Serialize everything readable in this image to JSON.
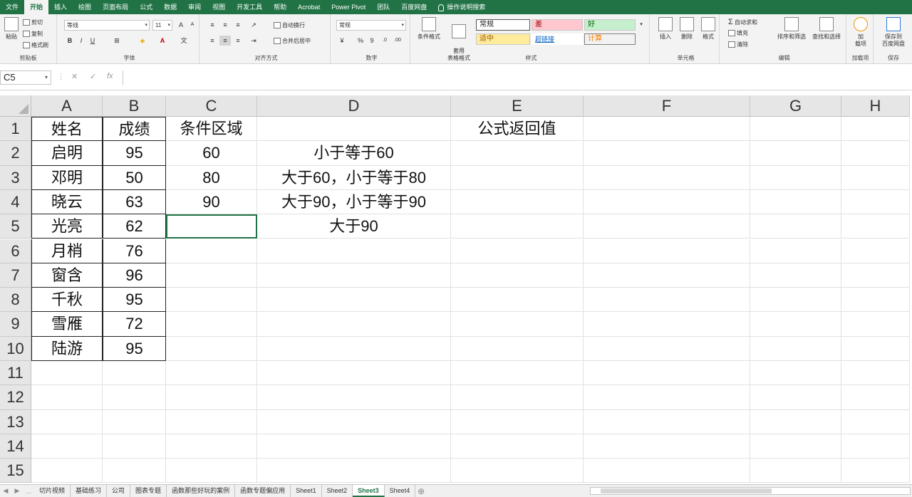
{
  "ribbon_tabs": [
    "文件",
    "开始",
    "插入",
    "绘图",
    "页面布局",
    "公式",
    "数据",
    "审阅",
    "视图",
    "开发工具",
    "帮助",
    "Acrobat",
    "Power Pivot",
    "团队",
    "百度网盘",
    "操作说明搜索"
  ],
  "active_tab": "开始",
  "clipboard": {
    "paste": "粘贴",
    "cut": "剪切",
    "copy": "复制",
    "format_painter": "格式刷",
    "label": "剪贴板"
  },
  "font": {
    "name": "等线",
    "size": "11",
    "bold": "B",
    "italic": "I",
    "underline": "U",
    "grow": "A",
    "shrink": "A",
    "label": "字体"
  },
  "alignment": {
    "wrap": "自动换行",
    "merge": "合并后居中",
    "label": "对齐方式"
  },
  "number": {
    "format": "常规",
    "percent": "%",
    "comma": "9",
    "label": "数字"
  },
  "styles": {
    "conditional": "条件格式",
    "table": "套用\n表格格式",
    "normal": "常规",
    "bad": "差",
    "good": "好",
    "neutral": "适中",
    "hyperlink": "超链接",
    "calc": "计算",
    "label": "样式"
  },
  "cells_group": {
    "insert": "插入",
    "delete": "删除",
    "format": "格式",
    "label": "单元格"
  },
  "editing": {
    "autosum": "自动求和",
    "fill": "填充",
    "clear": "清除",
    "sort": "排序和筛选",
    "find": "查找和选择",
    "label": "编辑"
  },
  "addins": {
    "add": "加\n载项",
    "label": "加载项"
  },
  "save": {
    "baidu": "保存到\n百度网盘",
    "label": "保存"
  },
  "formula_bar": {
    "name_box": "C5",
    "cancel": "✕",
    "confirm": "✓",
    "fx": "fx",
    "value": ""
  },
  "columns": [
    "A",
    "B",
    "C",
    "D",
    "E",
    "F",
    "G",
    "H"
  ],
  "rows": [
    "1",
    "2",
    "3",
    "4",
    "5",
    "6",
    "7",
    "8",
    "9",
    "10",
    "11",
    "12",
    "13",
    "14",
    "15"
  ],
  "cells": {
    "A1": "姓名",
    "B1": "成绩",
    "C1": "条件区域",
    "E1": "公式返回值",
    "A2": "启明",
    "B2": "95",
    "C2": "60",
    "D2": "小于等于60",
    "A3": "邓明",
    "B3": "50",
    "C3": "80",
    "D3": "大于60，小于等于80",
    "A4": "晓云",
    "B4": "63",
    "C4": "90",
    "D4": "大于90，小于等于90",
    "A5": "光亮",
    "B5": "62",
    "D5": "大于90",
    "A6": "月梢",
    "B6": "76",
    "A7": "窗含",
    "B7": "96",
    "A8": "千秋",
    "B8": "95",
    "A9": "雪雁",
    "B9": "72",
    "A10": "陆游",
    "B10": "95"
  },
  "sheet_tabs": [
    "切片视频",
    "基础练习",
    "公司",
    "图表专题",
    "函数那些好玩的案例",
    "函数专题偏应用",
    "Sheet1",
    "Sheet2",
    "Sheet3",
    "Sheet4"
  ],
  "active_sheet": "Sheet3",
  "add_sheet": "⊕"
}
